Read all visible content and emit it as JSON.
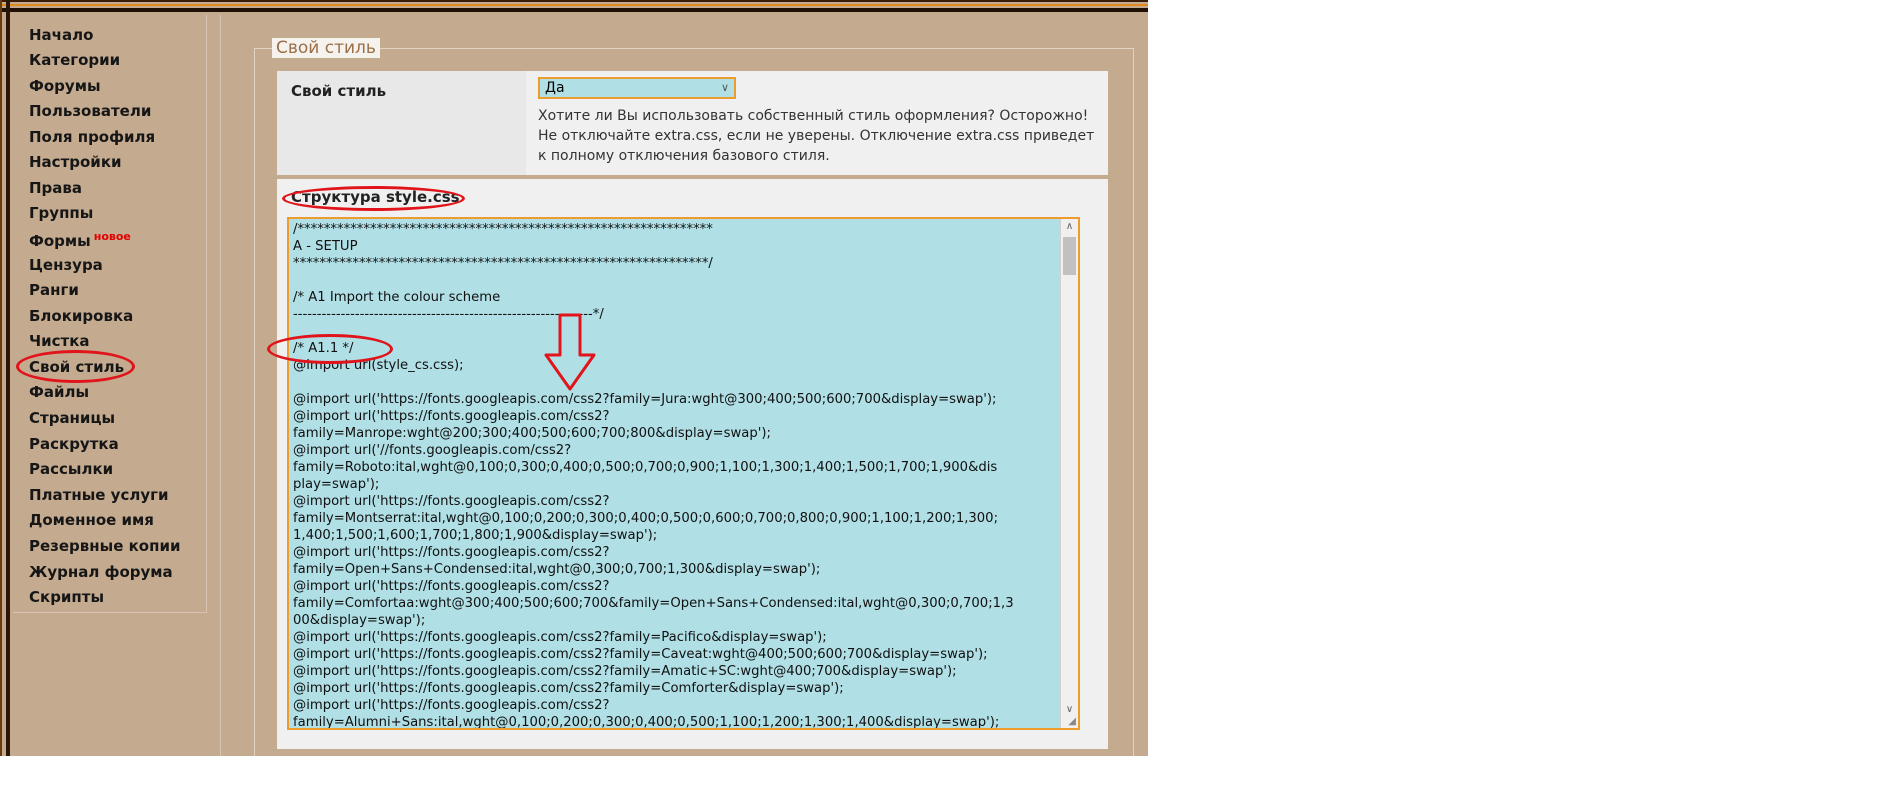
{
  "colors": {
    "page_bg": "#c4aa8f",
    "panel_label_bg": "#e8e8e8",
    "panel_bg": "#f0f0f0",
    "field_bg": "#b0dfe5",
    "focus_border": "#ed9c2e",
    "legend_text": "#9a6f48",
    "new_badge": "#e50000",
    "annotation": "#e0141a"
  },
  "sidebar": {
    "items": [
      {
        "label": "Начало"
      },
      {
        "label": "Категории"
      },
      {
        "label": "Форумы"
      },
      {
        "label": "Пользователи"
      },
      {
        "label": "Поля профиля"
      },
      {
        "label": "Настройки"
      },
      {
        "label": "Права"
      },
      {
        "label": "Группы"
      },
      {
        "label": "Формы",
        "badge": "новое"
      },
      {
        "label": "Цензура"
      },
      {
        "label": "Ранги"
      },
      {
        "label": "Блокировка"
      },
      {
        "label": "Чистка"
      },
      {
        "label": "Свой стиль",
        "active": true
      },
      {
        "label": "Файлы"
      },
      {
        "label": "Страницы"
      },
      {
        "label": "Раскрутка"
      },
      {
        "label": "Рассылки"
      },
      {
        "label": "Платные услуги"
      },
      {
        "label": "Доменное имя"
      },
      {
        "label": "Резервные копии"
      },
      {
        "label": "Журнал форума"
      },
      {
        "label": "Скрипты"
      }
    ]
  },
  "section": {
    "legend": "Свой стиль",
    "own_style": {
      "label": "Свой стиль",
      "value": "Да",
      "help": "Хотите ли Вы использовать собственный стиль оформления? Осторожно! Не отключайте extra.css, если не уверены. Отключение extra.css приведет к полному отключения базового стиля."
    },
    "structure": {
      "label": "Структура style.css",
      "lines": [
        "/***************************************************************",
        "A - SETUP",
        "***************************************************************/",
        "",
        "/* A1 Import the colour scheme",
        "---------------------------------------------------------------*/",
        "",
        "/* A1.1 */",
        "@import url(style_cs.css);",
        "",
        "@import url('https://fonts.googleapis.com/css2?family=Jura:wght@300;400;500;600;700&display=swap');",
        "@import url('https://fonts.googleapis.com/css2?",
        "family=Manrope:wght@200;300;400;500;600;700;800&display=swap');",
        "@import url('//fonts.googleapis.com/css2?",
        "family=Roboto:ital,wght@0,100;0,300;0,400;0,500;0,700;0,900;1,100;1,300;1,400;1,500;1,700;1,900&dis",
        "play=swap');",
        "@import url('https://fonts.googleapis.com/css2?",
        "family=Montserrat:ital,wght@0,100;0,200;0,300;0,400;0,500;0,600;0,700;0,800;0,900;1,100;1,200;1,300;",
        "1,400;1,500;1,600;1,700;1,800;1,900&display=swap');",
        "@import url('https://fonts.googleapis.com/css2?",
        "family=Open+Sans+Condensed:ital,wght@0,300;0,700;1,300&display=swap');",
        "@import url('https://fonts.googleapis.com/css2?",
        "family=Comfortaa:wght@300;400;500;600;700&family=Open+Sans+Condensed:ital,wght@0,300;0,700;1,3",
        "00&display=swap');",
        "@import url('https://fonts.googleapis.com/css2?family=Pacifico&display=swap');",
        "@import url('https://fonts.googleapis.com/css2?family=Caveat:wght@400;500;600;700&display=swap');",
        "@import url('https://fonts.googleapis.com/css2?family=Amatic+SC:wght@400;700&display=swap');",
        "@import url('https://fonts.googleapis.com/css2?family=Comforter&display=swap');",
        "@import url('https://fonts.googleapis.com/css2?",
        "family=Alumni+Sans:ital,wght@0,100;0,200;0,300;0,400;0,500;1,100;1,200;1,300;1,400&display=swap');"
      ]
    }
  },
  "icons": {
    "select_chevron": "chevron-down-icon",
    "scroll_up": "scroll-up-icon",
    "scroll_down": "scroll-down-icon",
    "resize": "resize-grip-icon",
    "arrow_annotation": "down-arrow-annotation"
  }
}
